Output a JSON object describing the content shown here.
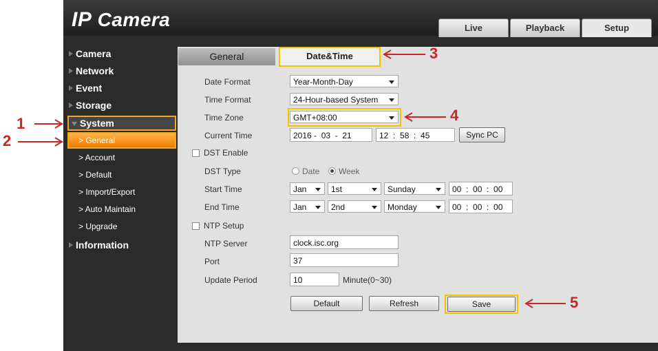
{
  "app": {
    "logo_bold": "IP",
    "logo_rest": " Camera"
  },
  "top_tabs": [
    {
      "label": "Live"
    },
    {
      "label": "Playback"
    },
    {
      "label": "Setup"
    }
  ],
  "sidebar": {
    "camera": "Camera",
    "network": "Network",
    "event": "Event",
    "storage": "Storage",
    "system": "System",
    "system_children": [
      {
        "label": "> General"
      },
      {
        "label": "> Account"
      },
      {
        "label": "> Default"
      },
      {
        "label": "> Import/Export"
      },
      {
        "label": "> Auto Maintain"
      },
      {
        "label": "> Upgrade"
      }
    ],
    "information": "Information"
  },
  "tabs": {
    "general": "General",
    "datetime": "Date&Time"
  },
  "form": {
    "date_format": {
      "label": "Date Format",
      "value": "Year-Month-Day"
    },
    "time_format": {
      "label": "Time Format",
      "value": "24-Hour-based System"
    },
    "time_zone": {
      "label": "Time Zone",
      "value": "GMT+08:00"
    },
    "current_time": {
      "label": "Current Time",
      "date_text": "2016 -  03  -  21",
      "time_text": "12  :  58  :  45",
      "sync_label": "Sync PC"
    },
    "dst_enable": {
      "label": "DST Enable",
      "checked": false
    },
    "dst_type": {
      "label": "DST Type",
      "opt_date": "Date",
      "opt_week": "Week",
      "selected": "Week"
    },
    "start_time": {
      "label": "Start Time",
      "month": "Jan",
      "week": "1st",
      "day": "Sunday",
      "time": "00  :  00  :  00"
    },
    "end_time": {
      "label": "End Time",
      "month": "Jan",
      "week": "2nd",
      "day": "Monday",
      "time": "00  :  00  :  00"
    },
    "ntp_setup": {
      "label": "NTP Setup",
      "checked": false
    },
    "ntp_server": {
      "label": "NTP Server",
      "value": "clock.isc.org"
    },
    "port": {
      "label": "Port",
      "value": "37"
    },
    "update_period": {
      "label": "Update Period",
      "value": "10",
      "unit": "Minute(0~30)"
    }
  },
  "buttons": {
    "default": "Default",
    "refresh": "Refresh",
    "save": "Save"
  },
  "markers": {
    "m1": "1",
    "m2": "2",
    "m3": "3",
    "m4": "4",
    "m5": "5"
  },
  "colors": {
    "highlight": "#f5c200",
    "annotation": "#c62828",
    "active_item": "#f07a00"
  }
}
